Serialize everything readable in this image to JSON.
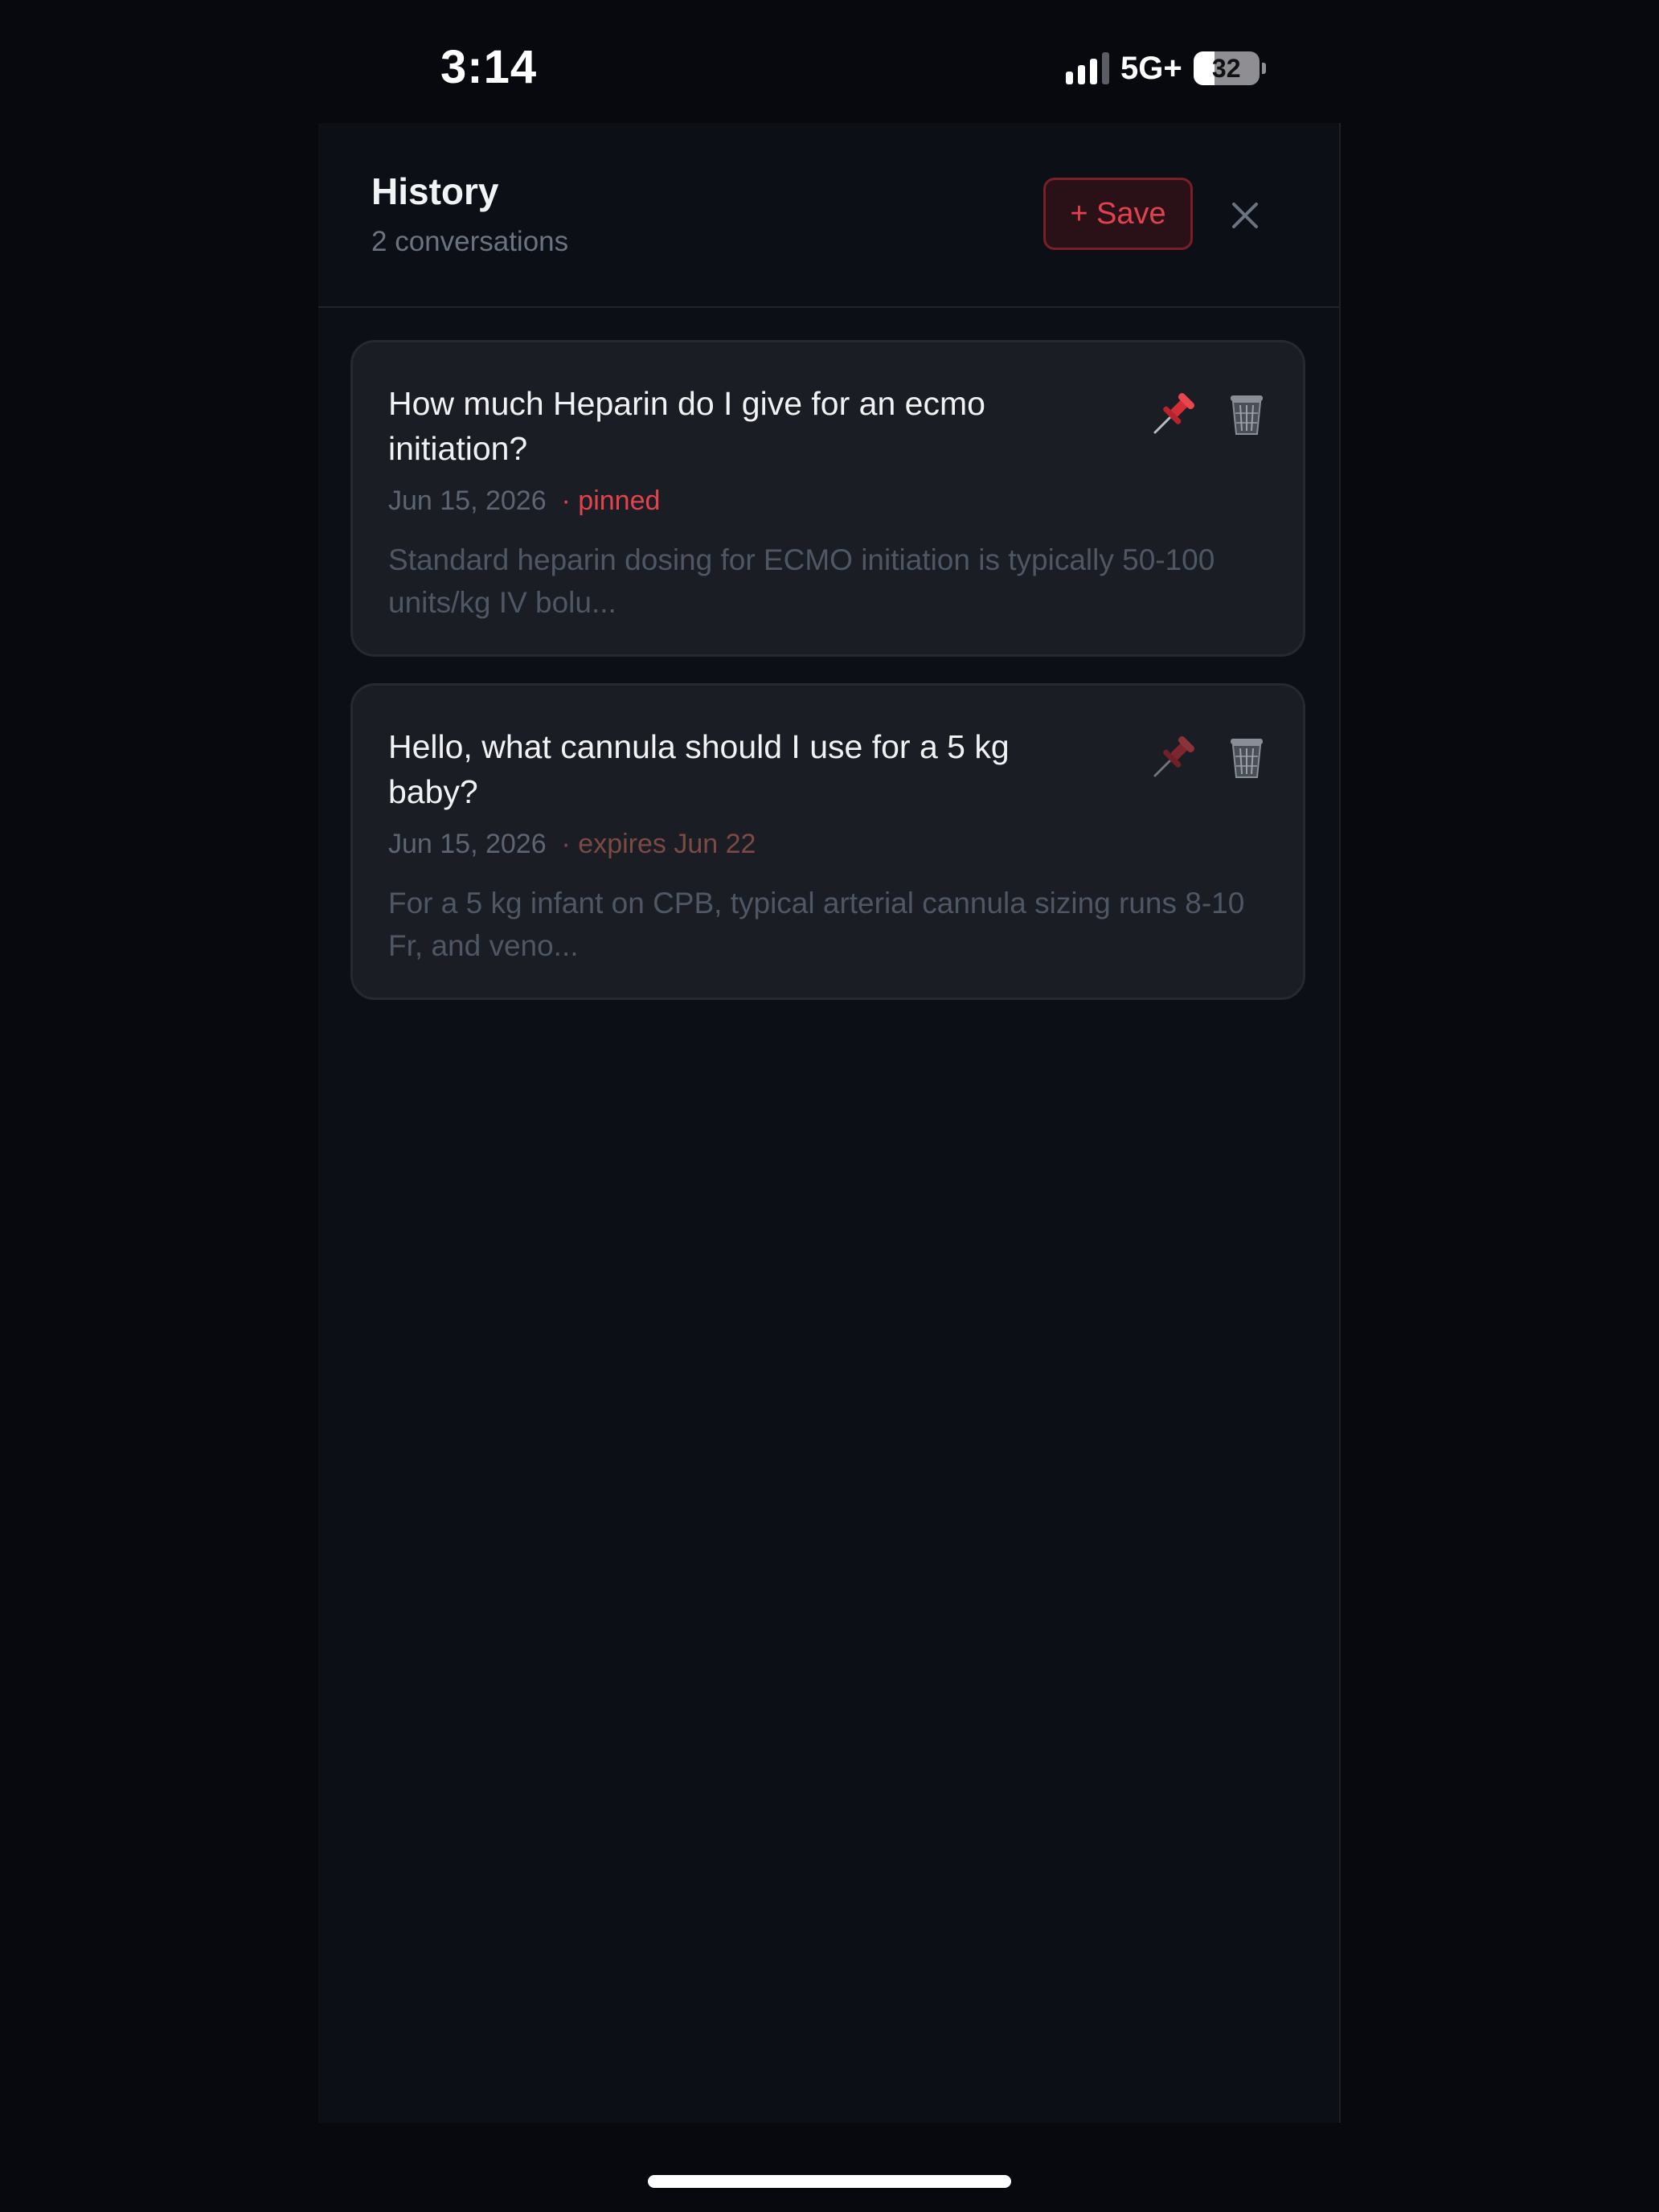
{
  "status_bar": {
    "time": "3:14",
    "network": "5G+",
    "battery_level": "32",
    "battery_fraction": 0.32,
    "signal_bars_active": 3,
    "signal_bars_total": 4
  },
  "panel": {
    "title": "History",
    "subtitle": "2 conversations",
    "save_label": "+ Save",
    "close_icon": "close-icon"
  },
  "conversations": [
    {
      "title": "How much Heparin do I give for an ecmo initiation?",
      "date": "Jun 15, 2026",
      "tag": "· pinned",
      "preview": "Standard heparin dosing for ECMO initiation is typically 50-100 units/kg IV bolu...",
      "pinned": true,
      "pin_icon": "pushpin-icon",
      "delete_icon": "trash-icon"
    },
    {
      "title": "Hello, what cannula should I use for a 5 kg baby?",
      "date": "Jun 15, 2026",
      "tag": "· expires Jun 22",
      "preview": "For a 5 kg infant on CPB, typical arterial cannula sizing runs 8-10 Fr, and veno...",
      "pinned": false,
      "pin_icon": "pushpin-icon",
      "delete_icon": "trash-icon"
    }
  ],
  "colors": {
    "accent_red": "#e3434d",
    "expires_tag": "#7b4a44",
    "panel_bg": "#0c0f16",
    "card_bg": "#1a1d23",
    "screen_bg": "#07090e"
  }
}
